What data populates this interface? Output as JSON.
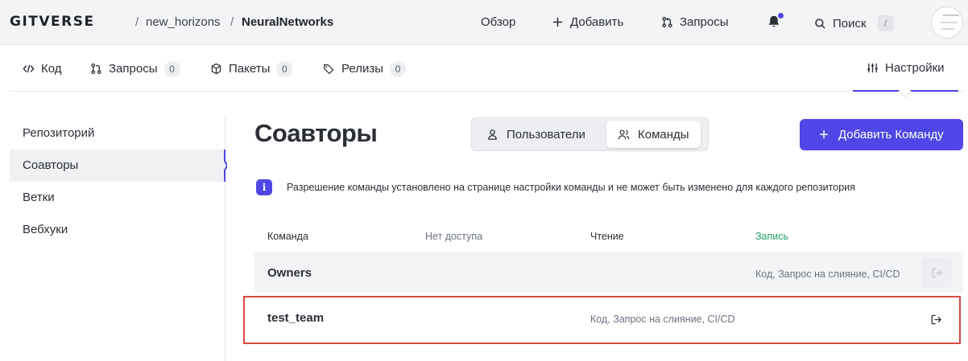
{
  "topbar": {
    "logo": "GITVERSE",
    "breadcrumb": {
      "sep1": "/",
      "owner": "new_horizons",
      "sep2": "/",
      "repo": "NeuralNetworks"
    },
    "nav": {
      "overview": "Обзор",
      "add": "Добавить",
      "requests": "Запросы",
      "search": "Поиск",
      "search_shortcut": "/"
    }
  },
  "tabs": {
    "code": "Код",
    "requests": "Запросы",
    "requests_count": "0",
    "packages": "Пакеты",
    "packages_count": "0",
    "releases": "Релизы",
    "releases_count": "0",
    "settings": "Настройки"
  },
  "sidebar": {
    "items": [
      "Репозиторий",
      "Соавторы",
      "Ветки",
      "Вебхуки"
    ],
    "active_index": 1
  },
  "main": {
    "title": "Соавторы",
    "segment": {
      "users": "Пользователи",
      "teams": "Команды",
      "active": "teams"
    },
    "add_button": "Добавить Команду",
    "info": "Разрешение команды установлено на странице настройки команды и не может быть изменено для каждого репозитория",
    "table": {
      "headers": {
        "team": "Команда",
        "no_access": "Нет доступа",
        "read": "Чтение",
        "write": "Запись"
      },
      "rows": [
        {
          "name": "Owners",
          "permission_level": "write",
          "permissions": "Код, Запрос на слияние, CI/CD"
        },
        {
          "name": "test_team",
          "permission_level": "read",
          "permissions": "Код, Запрос на слияние, CI/CD"
        }
      ]
    }
  },
  "colors": {
    "accent": "#4f46e5",
    "write_header": "#22a06b",
    "highlight_border": "#d9473f"
  }
}
